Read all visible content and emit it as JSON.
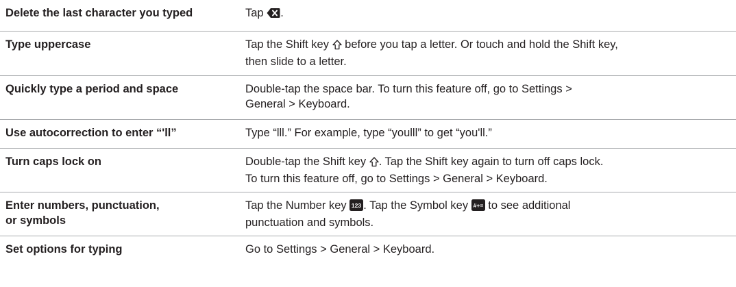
{
  "rows": [
    {
      "term": "Delete the last character you typed",
      "desc_before": "Tap ",
      "desc_icon": "delete-key-icon",
      "desc_after": "."
    },
    {
      "term": "Type uppercase",
      "desc_line1_before": "Tap the Shift key ",
      "desc_icon": "shift-key-icon",
      "desc_line1_after": " before you tap a letter. Or touch and hold the Shift key,",
      "desc_line2": "then slide to a letter."
    },
    {
      "term": "Quickly type a period and space",
      "desc_line1": "Double-tap the space bar. To turn this feature off, go to Settings >",
      "desc_line2": "General > Keyboard."
    },
    {
      "term": "Use autocorrection to enter “'ll”",
      "desc": "Type “lll.” For example, type “youlll” to get “you'll.”"
    },
    {
      "term": "Turn caps lock on",
      "desc_line1_before": "Double-tap the Shift key ",
      "desc_icon": "shift-key-icon",
      "desc_line1_after": ". Tap the Shift key again to turn off caps lock.",
      "desc_line2": "To turn this feature off, go to Settings > General > Keyboard."
    },
    {
      "term_line1": "Enter numbers, punctuation,",
      "term_line2": "or symbols",
      "desc_line1_a": "Tap the Number key ",
      "desc_icon_a": "number-key-icon",
      "desc_line1_b": ". Tap the Symbol key ",
      "desc_icon_b": "symbol-key-icon",
      "desc_line1_c": " to see additional",
      "desc_line2": "punctuation and symbols."
    },
    {
      "term": "Set options for typing",
      "desc": "Go to Settings > General > Keyboard."
    }
  ],
  "colors": {
    "text": "#231f20",
    "divider": "#a7a9ac",
    "key_fill": "#231f20"
  },
  "key_labels": {
    "number": "123",
    "symbol": "#+="
  }
}
